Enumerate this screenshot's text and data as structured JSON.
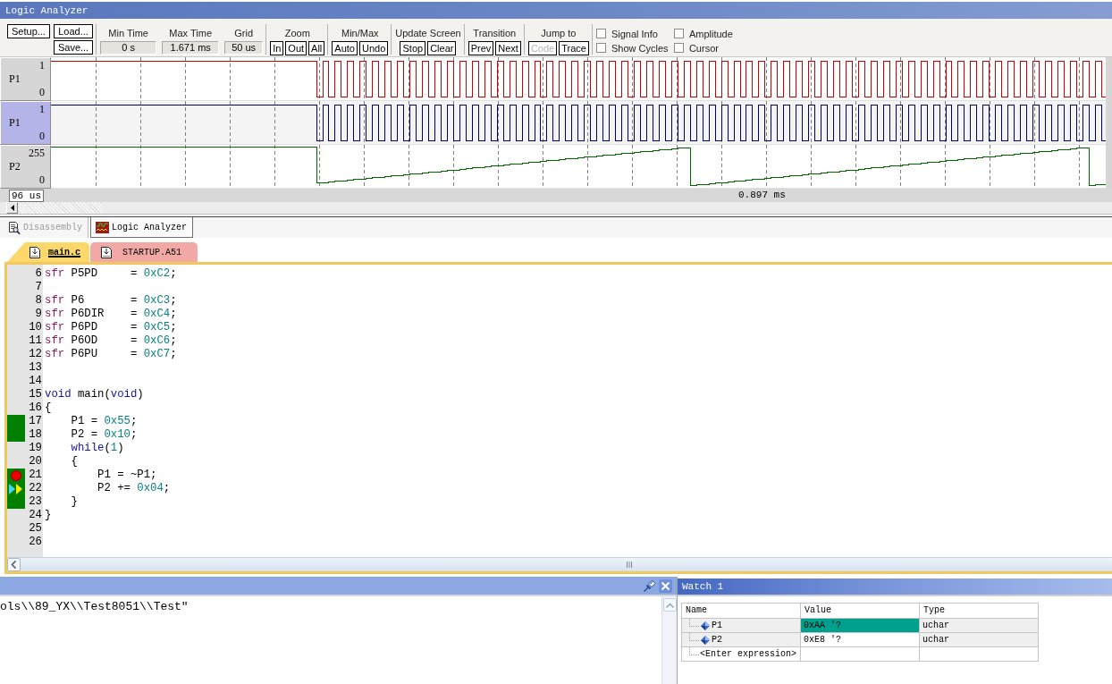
{
  "window": {
    "title": "Logic Analyzer"
  },
  "toolbar": {
    "file_buttons": [
      "Setup...",
      "Load...",
      "Save..."
    ],
    "readouts": [
      {
        "label": "Min Time",
        "value": "0 s"
      },
      {
        "label": "Max Time",
        "value": "1.671 ms"
      },
      {
        "label": "Grid",
        "value": "50 us"
      }
    ],
    "groups": [
      {
        "label": "Zoom",
        "buttons": [
          {
            "label": "In",
            "disabled": false
          },
          {
            "label": "Out",
            "disabled": false
          },
          {
            "label": "All",
            "disabled": false
          }
        ]
      },
      {
        "label": "Min/Max",
        "buttons": [
          {
            "label": "Auto",
            "disabled": false
          },
          {
            "label": "Undo",
            "disabled": false
          }
        ]
      },
      {
        "label": "Update Screen",
        "buttons": [
          {
            "label": "Stop",
            "disabled": false
          },
          {
            "label": "Clear",
            "disabled": false
          }
        ]
      },
      {
        "label": "Transition",
        "buttons": [
          {
            "label": "Prev",
            "disabled": false
          },
          {
            "label": "Next",
            "disabled": false
          }
        ]
      },
      {
        "label": "Jump to",
        "buttons": [
          {
            "label": "Code",
            "disabled": true
          },
          {
            "label": "Trace",
            "disabled": false
          }
        ]
      }
    ],
    "checkboxes": [
      {
        "label": "Signal Info",
        "checked": false
      },
      {
        "label": "Amplitude",
        "checked": false
      },
      {
        "label": "Show Cycles",
        "checked": false
      },
      {
        "label": "Cursor",
        "checked": false
      }
    ]
  },
  "signals": [
    {
      "name": "P1",
      "max": "1",
      "min": "0",
      "kind": "bit",
      "color": "#cc0000",
      "selected": false
    },
    {
      "name": "P1",
      "max": "1",
      "min": "0",
      "kind": "bit",
      "color": "#000066",
      "selected": true
    },
    {
      "name": "P2",
      "max": "255",
      "min": "0",
      "kind": "analog",
      "color": "#006600",
      "selected": false
    }
  ],
  "time_axis": {
    "start": "96 us",
    "cursor": "0.897 ms"
  },
  "view_tabs": [
    {
      "label": "Disassembly",
      "selected": false
    },
    {
      "label": "Logic Analyzer",
      "selected": true
    }
  ],
  "file_tabs": [
    {
      "label": "main.c",
      "selected": true
    },
    {
      "label": "STARTUP.A51",
      "selected": false
    }
  ],
  "editor": {
    "lines": [
      {
        "number": "6",
        "segments": [
          {
            "kind": "keyword",
            "text": "sfr"
          },
          {
            "kind": "plain",
            "text": " P5PD     = "
          },
          {
            "kind": "number",
            "text": "0xC2"
          },
          {
            "kind": "plain",
            "text": ";"
          }
        ],
        "coverage": false,
        "breakpoint": false,
        "current": false
      },
      {
        "number": "7",
        "coverage": false,
        "breakpoint": false,
        "current": false
      },
      {
        "number": "8",
        "segments": [
          {
            "kind": "keyword",
            "text": "sfr"
          },
          {
            "kind": "plain",
            "text": " P6       = "
          },
          {
            "kind": "number",
            "text": "0xC3"
          },
          {
            "kind": "plain",
            "text": ";"
          }
        ],
        "coverage": false,
        "breakpoint": false,
        "current": false
      },
      {
        "number": "9",
        "segments": [
          {
            "kind": "keyword",
            "text": "sfr"
          },
          {
            "kind": "plain",
            "text": " P6DIR    = "
          },
          {
            "kind": "number",
            "text": "0xC4"
          },
          {
            "kind": "plain",
            "text": ";"
          }
        ],
        "coverage": false,
        "breakpoint": false,
        "current": false
      },
      {
        "number": "10",
        "segments": [
          {
            "kind": "keyword",
            "text": "sfr"
          },
          {
            "kind": "plain",
            "text": " P6PD     = "
          },
          {
            "kind": "number",
            "text": "0xC5"
          },
          {
            "kind": "plain",
            "text": ";"
          }
        ],
        "coverage": false,
        "breakpoint": false,
        "current": false
      },
      {
        "number": "11",
        "segments": [
          {
            "kind": "keyword",
            "text": "sfr"
          },
          {
            "kind": "plain",
            "text": " P6OD     = "
          },
          {
            "kind": "number",
            "text": "0xC6"
          },
          {
            "kind": "plain",
            "text": ";"
          }
        ],
        "coverage": false,
        "breakpoint": false,
        "current": false
      },
      {
        "number": "12",
        "segments": [
          {
            "kind": "keyword",
            "text": "sfr"
          },
          {
            "kind": "plain",
            "text": " P6PU     = "
          },
          {
            "kind": "number",
            "text": "0xC7"
          },
          {
            "kind": "plain",
            "text": ";"
          }
        ],
        "coverage": false,
        "breakpoint": false,
        "current": false
      },
      {
        "number": "13",
        "coverage": false,
        "breakpoint": false,
        "current": false
      },
      {
        "number": "14",
        "coverage": false,
        "breakpoint": false,
        "current": false
      },
      {
        "number": "15",
        "segments": [
          {
            "kind": "type",
            "text": "void"
          },
          {
            "kind": "plain",
            "text": " main("
          },
          {
            "kind": "type",
            "text": "void"
          },
          {
            "kind": "plain",
            "text": ")"
          }
        ],
        "coverage": false,
        "breakpoint": false,
        "current": false
      },
      {
        "number": "16",
        "segments": [
          {
            "kind": "plain",
            "text": "{"
          }
        ],
        "coverage": false,
        "breakpoint": false,
        "current": false
      },
      {
        "number": "17",
        "segments": [
          {
            "kind": "plain",
            "text": "    P1 = "
          },
          {
            "kind": "number",
            "text": "0x55"
          },
          {
            "kind": "plain",
            "text": ";"
          }
        ],
        "coverage": true,
        "breakpoint": false,
        "current": false
      },
      {
        "number": "18",
        "segments": [
          {
            "kind": "plain",
            "text": "    P2 = "
          },
          {
            "kind": "number",
            "text": "0x10"
          },
          {
            "kind": "plain",
            "text": ";"
          }
        ],
        "coverage": true,
        "breakpoint": false,
        "current": false
      },
      {
        "number": "19",
        "segments": [
          {
            "kind": "type",
            "text": "    while"
          },
          {
            "kind": "plain",
            "text": "("
          },
          {
            "kind": "number",
            "text": "1"
          },
          {
            "kind": "plain",
            "text": ")"
          }
        ],
        "coverage": false,
        "breakpoint": false,
        "current": false
      },
      {
        "number": "20",
        "segments": [
          {
            "kind": "plain",
            "text": "    {"
          }
        ],
        "coverage": false,
        "breakpoint": false,
        "current": false
      },
      {
        "number": "21",
        "segments": [
          {
            "kind": "plain",
            "text": "        P1 = ~P1;"
          }
        ],
        "coverage": true,
        "breakpoint": true,
        "current": false
      },
      {
        "number": "22",
        "segments": [
          {
            "kind": "plain",
            "text": "        P2 += "
          },
          {
            "kind": "number",
            "text": "0x04"
          },
          {
            "kind": "plain",
            "text": ";"
          }
        ],
        "coverage": true,
        "breakpoint": false,
        "current": true
      },
      {
        "number": "23",
        "segments": [
          {
            "kind": "plain",
            "text": "    }"
          }
        ],
        "coverage": true,
        "breakpoint": false,
        "current": false
      },
      {
        "number": "24",
        "segments": [
          {
            "kind": "plain",
            "text": "}"
          }
        ],
        "coverage": false,
        "breakpoint": false,
        "current": false
      },
      {
        "number": "25",
        "coverage": false,
        "breakpoint": false,
        "current": false
      },
      {
        "number": "26",
        "coverage": false,
        "breakpoint": false,
        "current": false
      }
    ]
  },
  "output": {
    "text": "ols\\\\89_YX\\\\Test8051\\\\Test\""
  },
  "watch": {
    "title": "Watch 1",
    "columns": [
      "Name",
      "Value",
      "Type"
    ],
    "rows": [
      {
        "name": "P1",
        "value": "0xAA '?",
        "type": "uchar",
        "highlighted": true
      },
      {
        "name": "P2",
        "value": "0xE8 '?",
        "type": "uchar",
        "highlighted": false
      }
    ],
    "placeholder": "<Enter expression>"
  }
}
